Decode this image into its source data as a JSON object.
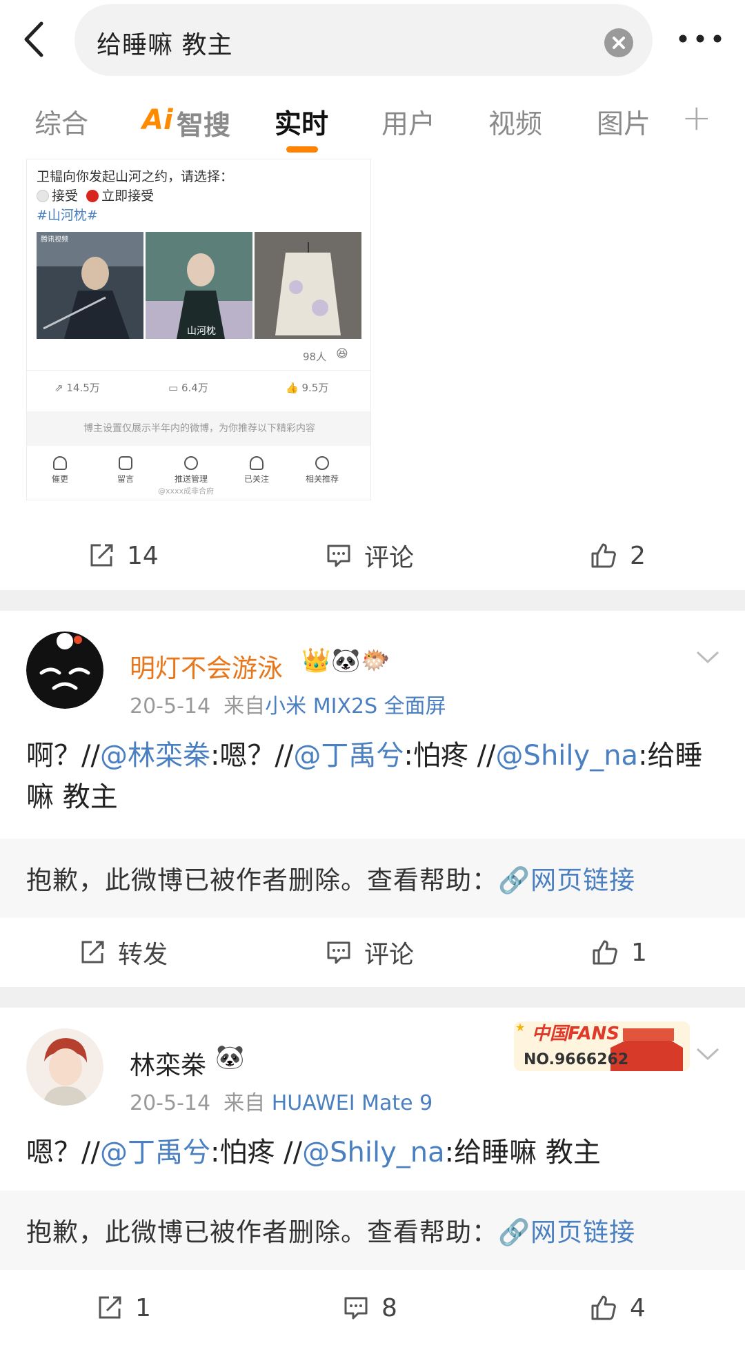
{
  "search": {
    "query": "给睡嘛 教主"
  },
  "tabs": [
    {
      "label": "综合"
    },
    {
      "label": "智搜",
      "ai_prefix": "Ai"
    },
    {
      "label": "实时"
    },
    {
      "label": "用户"
    },
    {
      "label": "视频"
    },
    {
      "label": "图片"
    }
  ],
  "embed": {
    "line1": "卫韫向你发起山河之约，请选择：",
    "option1": "接受",
    "option2": "立即接受",
    "hashtag": "#山河枕#",
    "img_caption": "腾讯视频",
    "img2_text": "山河枕",
    "likes_people": "98人",
    "repost": "14.5万",
    "comment": "6.4万",
    "like": "9.5万",
    "notice": "博主设置仅展示半年内的微博，为你推荐以下精彩内容",
    "nav": [
      "催更",
      "留言",
      "推送管理",
      "已关注",
      "相关推荐"
    ],
    "watermark": "@xxxx成非合府"
  },
  "top_actions": {
    "repost": "14",
    "comment": "评论",
    "like": "2"
  },
  "post1": {
    "username": "明灯不会游泳",
    "date": "20-5-14",
    "from_label": "来自",
    "source": "小米 MIX2S 全面屏",
    "body_prefix": "啊？//",
    "mention1": "@林栾桊",
    "text1": ":嗯？//",
    "mention2": "@丁禹兮",
    "text2": ":怕疼 //",
    "mention3": "@Shily_na",
    "text3": ":给睡嘛 教主",
    "deleted": "抱歉，此微博已被作者删除。查看帮助：",
    "link": "网页链接",
    "actions": {
      "repost": "转发",
      "comment": "评论",
      "like": "1"
    }
  },
  "post2": {
    "username": "林栾桊",
    "badge_title": "中国FANS",
    "badge_no": "NO.9666262",
    "date": "20-5-14",
    "from_label": "来自",
    "source": "HUAWEI Mate 9",
    "body_prefix": "嗯？//",
    "mention1": "@丁禹兮",
    "text1": ":怕疼 //",
    "mention2": "@Shily_na",
    "text2": ":给睡嘛 教主",
    "deleted": "抱歉，此微博已被作者删除。查看帮助：",
    "link": "网页链接",
    "actions": {
      "repost": "1",
      "comment": "8",
      "like": "4"
    }
  },
  "colors": {
    "accent": "#ff8200",
    "link": "#4a7fc1",
    "username_highlight": "#e8761a"
  }
}
